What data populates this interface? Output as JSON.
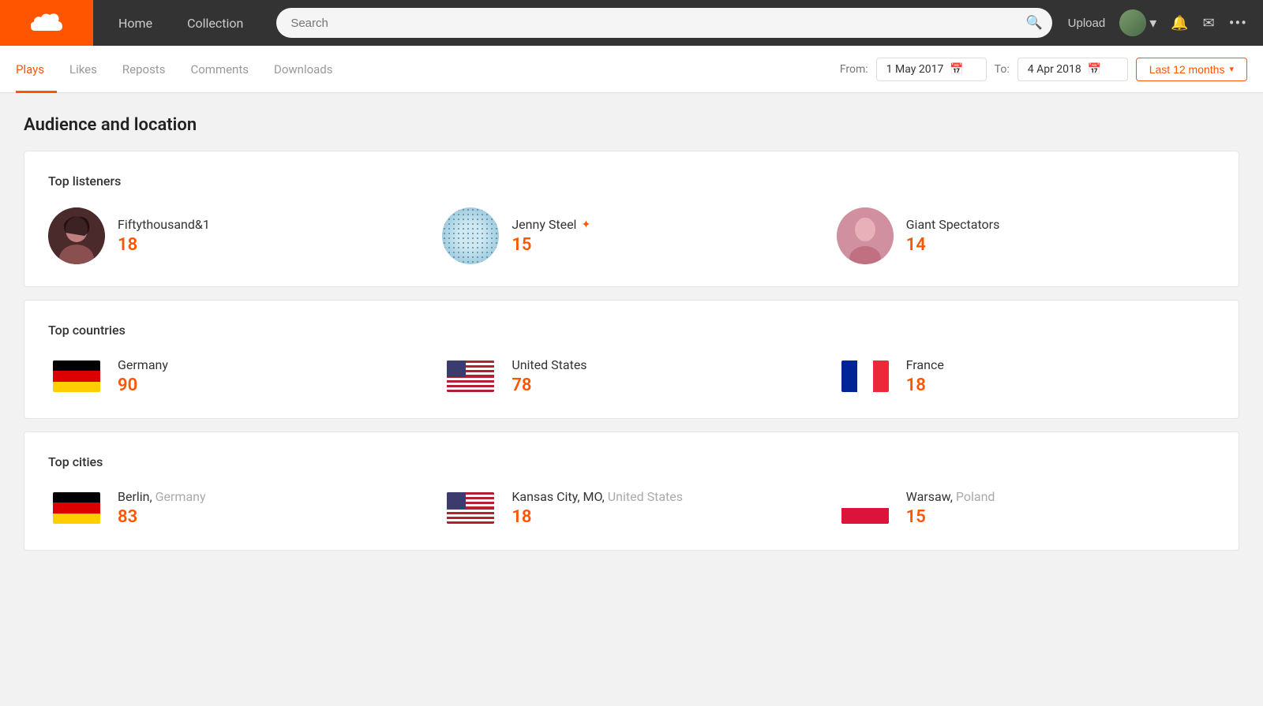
{
  "nav": {
    "home_label": "Home",
    "collection_label": "Collection",
    "search_placeholder": "Search",
    "upload_label": "Upload"
  },
  "sub_tabs": {
    "tabs": [
      {
        "id": "plays",
        "label": "Plays",
        "active": true
      },
      {
        "id": "likes",
        "label": "Likes",
        "active": false
      },
      {
        "id": "reposts",
        "label": "Reposts",
        "active": false
      },
      {
        "id": "comments",
        "label": "Comments",
        "active": false
      },
      {
        "id": "downloads",
        "label": "Downloads",
        "active": false
      }
    ],
    "from_label": "From:",
    "to_label": "To:",
    "from_date": "1 May 2017",
    "to_date": "4 Apr 2018",
    "last12_label": "Last 12 months"
  },
  "page": {
    "section_title": "Audience and location"
  },
  "top_listeners": {
    "title": "Top listeners",
    "items": [
      {
        "name": "Fiftythousand&1",
        "count": "18",
        "verified": false
      },
      {
        "name": "Jenny Steel",
        "count": "15",
        "verified": true
      },
      {
        "name": "Giant Spectators",
        "count": "14",
        "verified": false
      }
    ]
  },
  "top_countries": {
    "title": "Top countries",
    "items": [
      {
        "name": "Germany",
        "count": "90"
      },
      {
        "name": "United States",
        "count": "78"
      },
      {
        "name": "France",
        "count": "18"
      }
    ]
  },
  "top_cities": {
    "title": "Top cities",
    "items": [
      {
        "city": "Berlin,",
        "country": "Germany",
        "count": "83"
      },
      {
        "city": "Kansas City, MO,",
        "country": "United States",
        "count": "18"
      },
      {
        "city": "Warsaw,",
        "country": "Poland",
        "count": "15"
      }
    ]
  },
  "icons": {
    "search": "🔍",
    "calendar": "📅",
    "chevron_down": "▾",
    "bell": "🔔",
    "mail": "✉",
    "more": "•••",
    "verified_star": "✦"
  }
}
